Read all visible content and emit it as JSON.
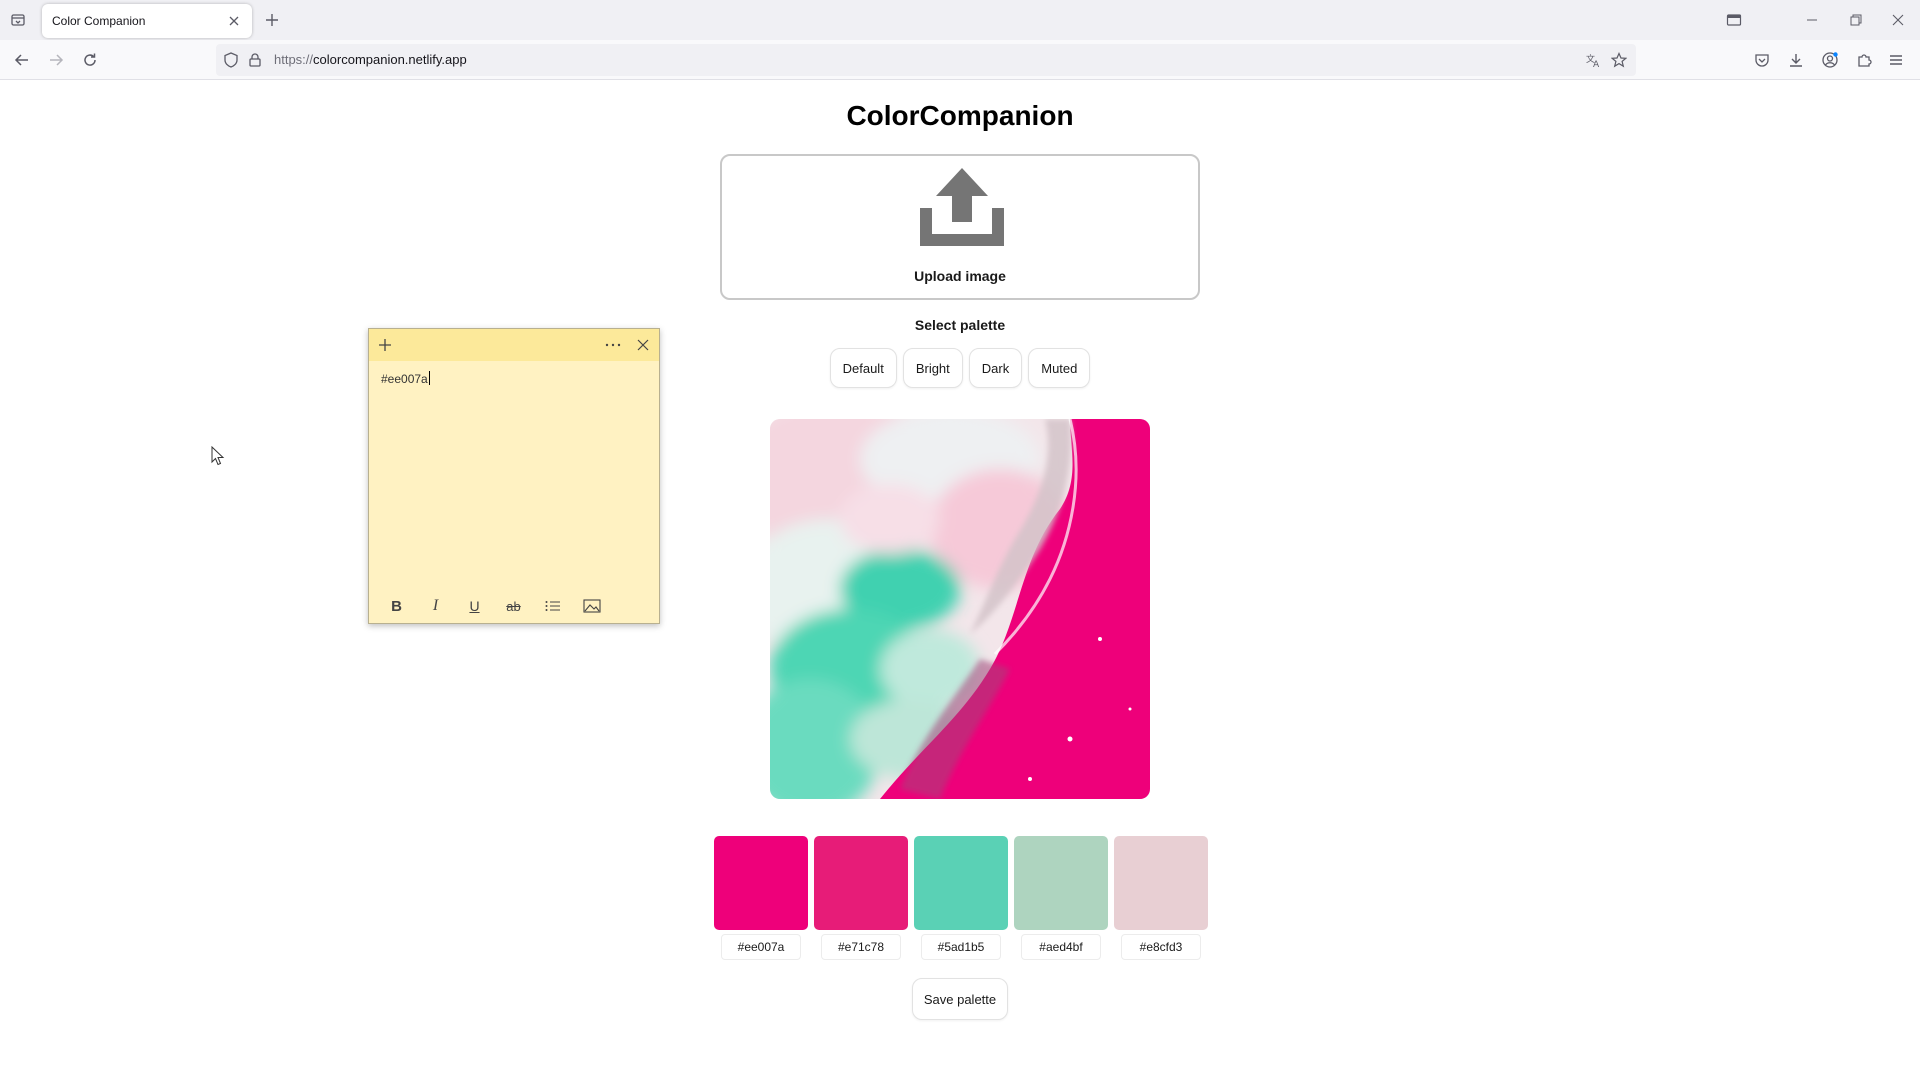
{
  "browser": {
    "tab_title": "Color Companion",
    "url_protocol": "https://",
    "url_host": "colorcompanion.netlify.app"
  },
  "page": {
    "title": "ColorCompanion",
    "upload_label": "Upload image",
    "select_label": "Select palette",
    "palette_options": [
      "Default",
      "Bright",
      "Dark",
      "Muted"
    ],
    "save_label": "Save palette"
  },
  "palette": [
    {
      "hex": "#ee007a",
      "color": "#ee007a"
    },
    {
      "hex": "#e71c78",
      "color": "#e71c78"
    },
    {
      "hex": "#5ad1b5",
      "color": "#5ad1b5"
    },
    {
      "hex": "#aed4bf",
      "color": "#aed4bf"
    },
    {
      "hex": "#e8cfd3",
      "color": "#e8cfd3"
    }
  ],
  "sticky_note": {
    "text": "#ee007a"
  },
  "icons": {
    "upload": "upload-arrow-tray-icon",
    "sticky_add": "plus-icon",
    "sticky_menu": "more-horizontal-icon",
    "sticky_close": "close-icon",
    "format": [
      "bold-icon",
      "italic-icon",
      "underline-icon",
      "strikethrough-icon",
      "list-icon",
      "image-icon"
    ]
  },
  "colors": {
    "sticky_body": "#fff2c2",
    "sticky_header": "#fce99a",
    "upload_icon": "#757575"
  }
}
